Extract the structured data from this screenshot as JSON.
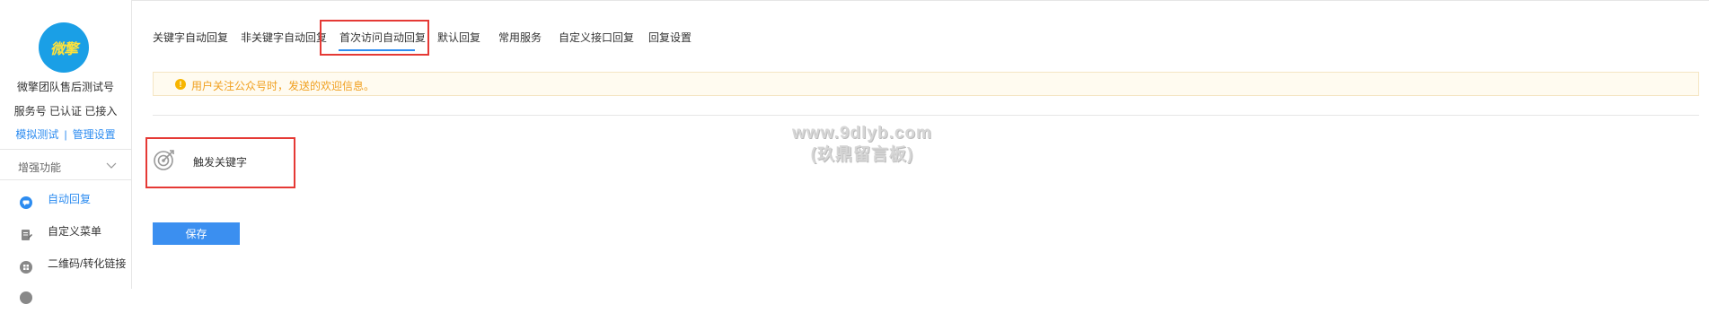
{
  "sidebar": {
    "logo_text": "微擎",
    "account_name": "微擎团队售后测试号",
    "account_status": "服务号 已认证 已接入",
    "links": {
      "simulate": "模拟测试",
      "separator": "|",
      "manage": "管理设置"
    },
    "section_title": "增强功能",
    "items": [
      {
        "label": "自动回复",
        "icon": "chat-bubble-icon",
        "color": "#2d8cf0"
      },
      {
        "label": "自定义菜单",
        "icon": "document-edit-icon",
        "color": "#888888"
      },
      {
        "label": "二维码/转化链接",
        "icon": "qrcode-icon",
        "color": "#888888"
      }
    ]
  },
  "tabs": [
    {
      "label": "关键字自动回复"
    },
    {
      "label": "非关键字自动回复"
    },
    {
      "label": "首次访问自动回复",
      "active": true
    },
    {
      "label": "默认回复"
    },
    {
      "label": "常用服务"
    },
    {
      "label": "自定义接口回复"
    },
    {
      "label": "回复设置"
    }
  ],
  "notice": {
    "text": "用户关注公众号时，发送的欢迎信息。",
    "color": "#f0a020"
  },
  "trigger": {
    "label": "触发关键字",
    "icon": "target-icon"
  },
  "save_label": "保存",
  "watermark": {
    "line1": "www.9dlyb.com",
    "line2": "(玖鼎留言板)"
  },
  "colors": {
    "accent": "#2d8cf0",
    "highlight_box": "#e53935",
    "button": "#3b8ff0"
  }
}
